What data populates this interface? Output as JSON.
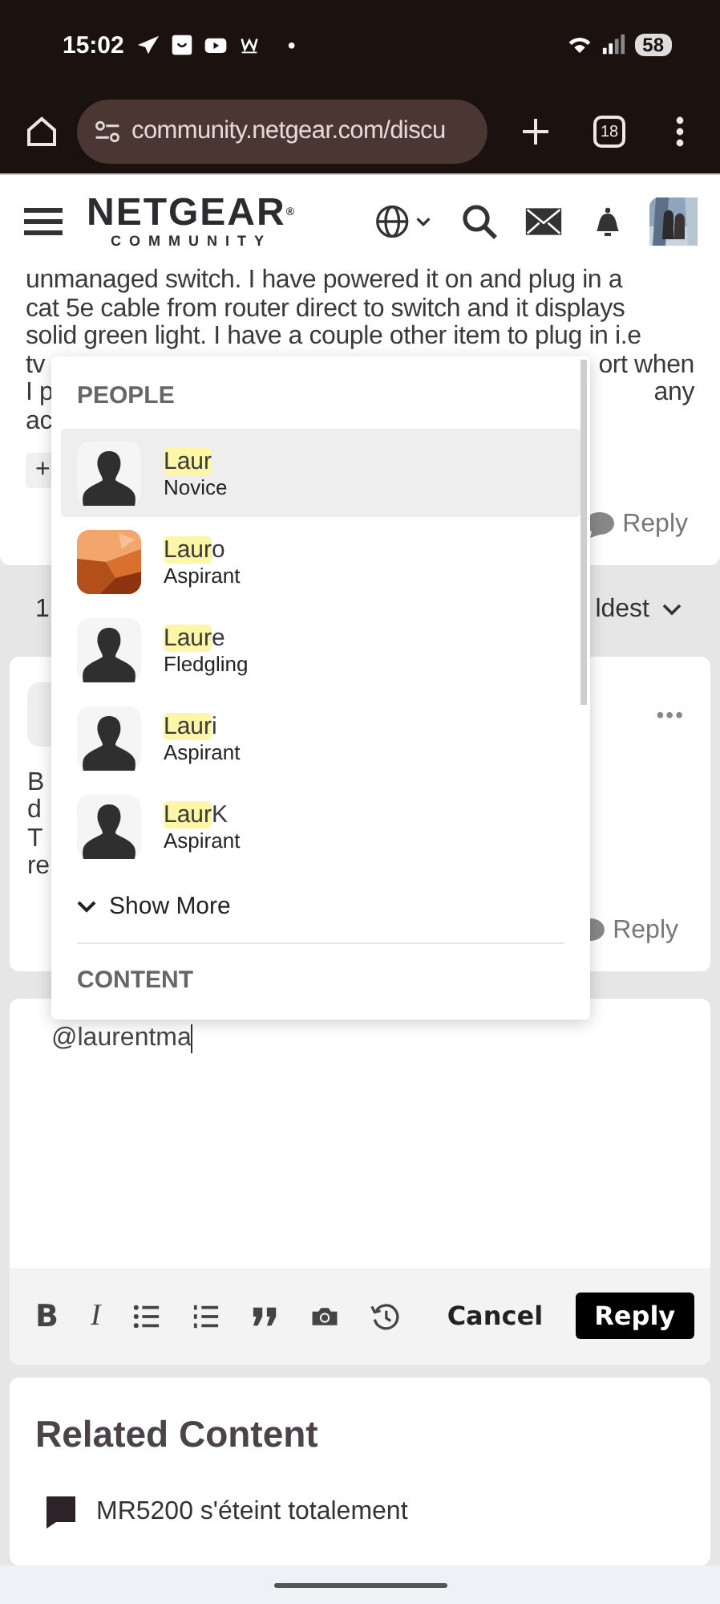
{
  "status_bar": {
    "time": "15:02",
    "notification_dot": "•",
    "battery": "58"
  },
  "browser": {
    "url": "community.netgear.com/discu",
    "tab_count": "18"
  },
  "header": {
    "logo": "NETGEAR",
    "logo_mark": "®",
    "logo_sub": "COMMUNITY"
  },
  "post": {
    "lines": [
      {
        "left": "unmanaged switch. I have powered it on and plug in a"
      },
      {
        "left": "cat 5e cable from router direct to switch and it displays"
      },
      {
        "left": "solid green light. I have a couple other item to plug in i.e"
      },
      {
        "left": "tv",
        "right": "ort when"
      },
      {
        "left": "I p",
        "right": "any"
      },
      {
        "left": "ac"
      }
    ],
    "chip": "+",
    "reply": "Reply"
  },
  "sort_bar": {
    "count": "1",
    "sort": "ldest"
  },
  "reply_card": {
    "lines": [
      "B",
      "d",
      "T",
      "re"
    ],
    "more": "•••",
    "reply": "Reply"
  },
  "mention_menu": {
    "people_heading": "PEOPLE",
    "people": [
      {
        "match": "Laur",
        "rank": "Novice",
        "kind": "silhouette",
        "selected": true
      },
      {
        "match": "Laur",
        "rest": "o",
        "rank": "Aspirant",
        "kind": "picture",
        "selected": false
      },
      {
        "match": "Laur",
        "rest": "e",
        "rank": "Fledgling",
        "kind": "silhouette",
        "selected": false
      },
      {
        "match": "Laur",
        "rest": "i",
        "rank": "Aspirant",
        "kind": "silhouette",
        "selected": false
      },
      {
        "match": "Laur",
        "rest": "K",
        "rank": "Aspirant",
        "kind": "silhouette",
        "selected": false
      }
    ],
    "show_more": "Show More",
    "content_heading": "CONTENT"
  },
  "editor": {
    "value": "@laurentma",
    "toolbar": [
      {
        "kind": "bold",
        "label": "B"
      },
      {
        "kind": "italic",
        "label": "I"
      },
      {
        "kind": "bullets"
      },
      {
        "kind": "numbers"
      },
      {
        "kind": "quote"
      },
      {
        "kind": "camera"
      },
      {
        "kind": "history"
      }
    ],
    "cancel": "Cancel",
    "reply": "Reply"
  },
  "related": {
    "title": "Related Content",
    "items": [
      "MR5200 s'éteint totalement"
    ]
  }
}
